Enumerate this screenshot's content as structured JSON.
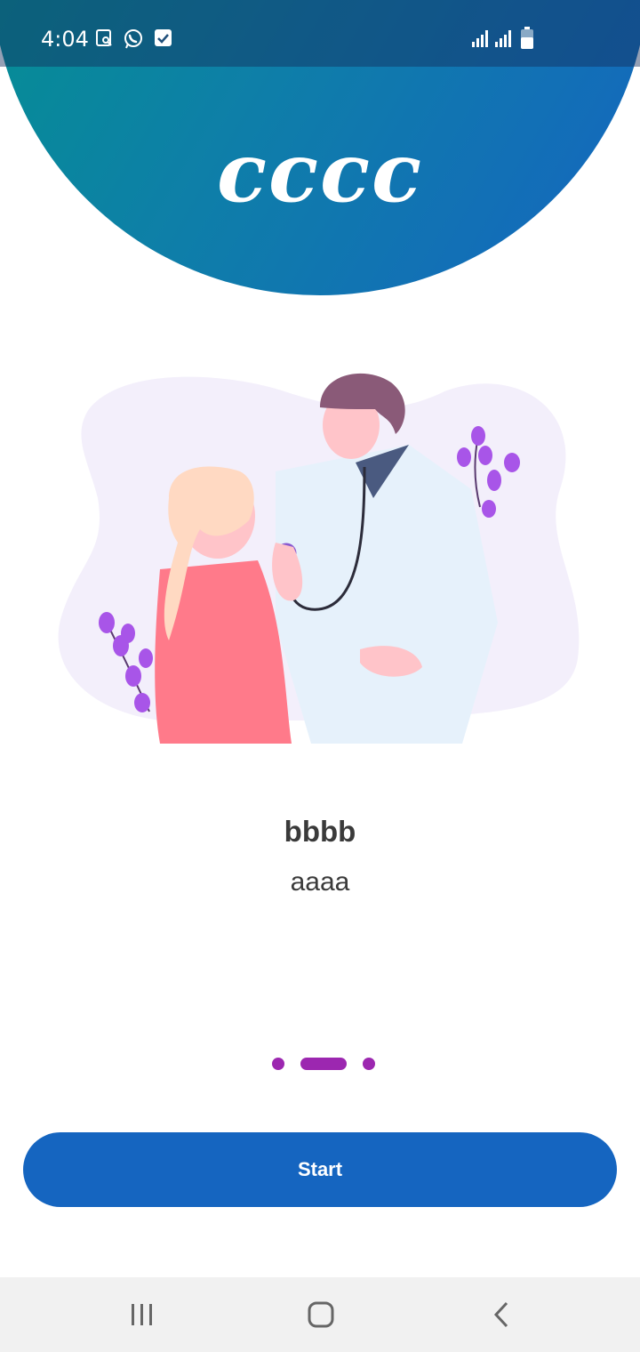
{
  "status_bar": {
    "time": "4:04",
    "icons": [
      "screenshot-icon",
      "whatsapp-icon",
      "checkbox-icon",
      "signal-icon",
      "signal-icon",
      "battery-icon"
    ]
  },
  "header": {
    "brand": "cccc"
  },
  "slide": {
    "title": "bbbb",
    "subtitle": "aaaa"
  },
  "pager": {
    "count": 3,
    "active_index": 1
  },
  "actions": {
    "start_label": "Start"
  },
  "nav_bar": {
    "icons": [
      "recent-apps-icon",
      "home-icon",
      "back-icon"
    ]
  },
  "colors": {
    "gradient_start": "#009688",
    "gradient_end": "#1565c0",
    "primary": "#1565c0",
    "indicator": "#9c27b0",
    "text": "#3a3a3a"
  }
}
